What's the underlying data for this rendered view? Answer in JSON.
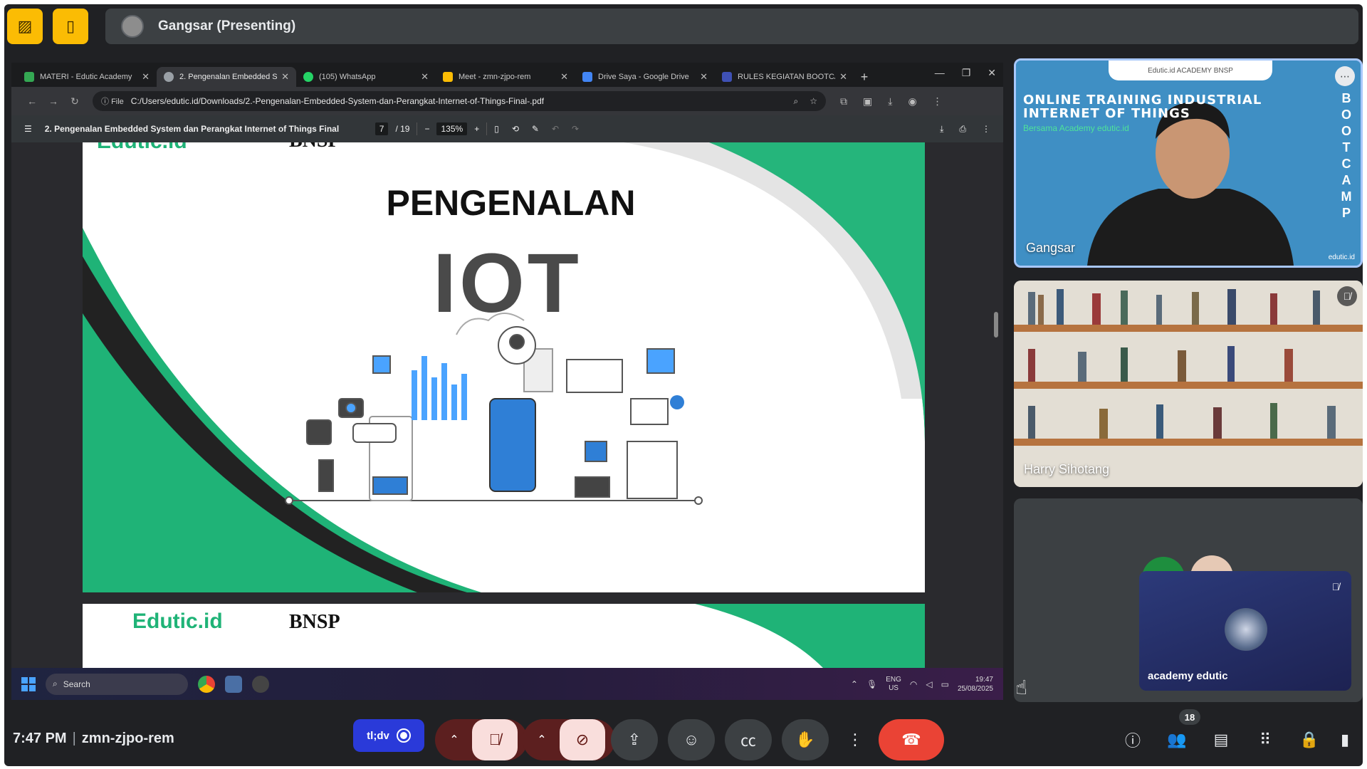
{
  "presenter": {
    "name": "Gangsar (Presenting)"
  },
  "browser": {
    "tabs": [
      {
        "label": "MATERI - Edutic Academy",
        "color": "#34a853"
      },
      {
        "label": "2. Pengenalan Embedded S",
        "color": "#9aa0a6"
      },
      {
        "label": "(105) WhatsApp",
        "color": "#25d366"
      },
      {
        "label": "Meet - zmn-zjpo-rem",
        "color": "#fbbc04"
      },
      {
        "label": "Drive Saya - Google Drive",
        "color": "#4285f4"
      },
      {
        "label": "RULES KEGIATAN BOOTCA",
        "color": "#3f51b5"
      }
    ],
    "new_tab": "+",
    "file_chip": "File",
    "url": "C:/Users/edutic.id/Downloads/2.-Pengenalan-Embedded-System-dan-Perangkat-Internet-of-Things-Final-.pdf"
  },
  "pdf": {
    "title": "2. Pengenalan Embedded System dan Perangkat Internet of Things Final",
    "page_current": "7",
    "page_total": "/ 19",
    "zoom": "135%"
  },
  "slide": {
    "title": "PENGENALAN",
    "big": "IOT",
    "logo": "Edutic.id",
    "bnsp": "BNSP"
  },
  "taskbar": {
    "search": "Search",
    "lang_top": "ENG",
    "lang_bottom": "US",
    "time": "19:47",
    "date": "25/08/2025"
  },
  "tiles": {
    "tile1": {
      "header_line1": "ONLINE TRAINING INDUSTRIAL",
      "header_line2": "INTERNET OF THINGS",
      "sub": "Bersama Academy edutic.id",
      "side": "BOOTCAMP",
      "bar": "Edutic.id  ACADEMY  BNSP",
      "name": "Gangsar",
      "foot": "edutic.id"
    },
    "tile2": {
      "name": "Harry Sihotang"
    },
    "tile3": {
      "self_name": "academy edutic"
    }
  },
  "bottom": {
    "time": "7:47 PM",
    "meeting_code": "zmn-zjpo-rem",
    "tldv_label": "tl;dv",
    "participant_count": "18"
  },
  "icons": {
    "present_off": "presentation-off-icon",
    "layout": "layout-icon",
    "mic_off": "mic-off-icon",
    "cam_off": "camera-off-icon",
    "present": "present-screen-icon",
    "emoji": "emoji-icon",
    "captions": "captions-icon",
    "hand": "raise-hand-icon",
    "more": "more-vert-icon",
    "end": "end-call-icon",
    "info": "info-icon",
    "people": "people-icon",
    "chat": "chat-icon",
    "activities": "apps-grid-icon",
    "host": "host-controls-icon"
  },
  "colors": {
    "accent_yellow": "#fbbc04",
    "end_call": "#ea4335",
    "mic_off_bg": "#f9dedc",
    "slide_green": "#1fb377"
  }
}
